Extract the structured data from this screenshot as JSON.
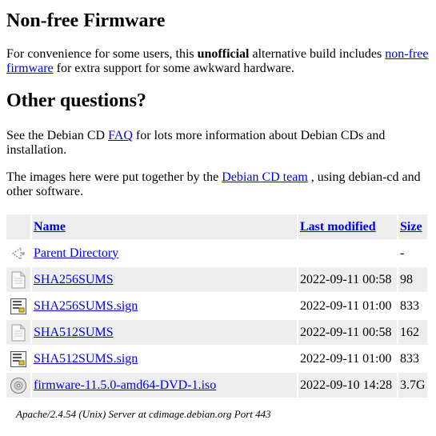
{
  "firmware_section": {
    "heading": "Non-free Firmware",
    "text_before_bold": "For convenience for some users, this ",
    "bold": "unofficial",
    "text_after_bold": " alternative build includes ",
    "link": "non-free firmware",
    "text_end": " for extra support for some awkward hardware."
  },
  "questions_section": {
    "heading": "Other questions?",
    "faq_before": "See the Debian CD ",
    "faq_link": "FAQ",
    "faq_after": " for lots more information about Debian CDs and installation.",
    "team_before": "The images here were put together by the ",
    "team_link": "Debian CD team",
    "team_after": " , using debian-cd and other software."
  },
  "listing": {
    "headers": {
      "name": "Name",
      "modified": "Last modified",
      "size": "Size"
    },
    "rows": [
      {
        "icon": "back-icon",
        "name": "Parent Directory",
        "modified": "",
        "size": "-"
      },
      {
        "icon": "text-file-icon",
        "name": "SHA256SUMS",
        "modified": "2022-09-11 00:58",
        "size": "98"
      },
      {
        "icon": "signature-file-icon",
        "name": "SHA256SUMS.sign",
        "modified": "2022-09-11 01:00",
        "size": "833"
      },
      {
        "icon": "text-file-icon",
        "name": "SHA512SUMS",
        "modified": "2022-09-11 00:58",
        "size": "162"
      },
      {
        "icon": "signature-file-icon",
        "name": "SHA512SUMS.sign",
        "modified": "2022-09-11 01:00",
        "size": "833"
      },
      {
        "icon": "disc-image-icon",
        "name": "firmware-11.5.0-amd64-DVD-1.iso",
        "modified": "2022-09-10 14:28",
        "size": "3.7G"
      }
    ]
  },
  "footer": {
    "address": "Apache/2.4.54 (Unix) Server at cdimage.debian.org Port 443"
  },
  "colors": {
    "link": "#0000ee",
    "row_shade": "#eeeeee"
  }
}
